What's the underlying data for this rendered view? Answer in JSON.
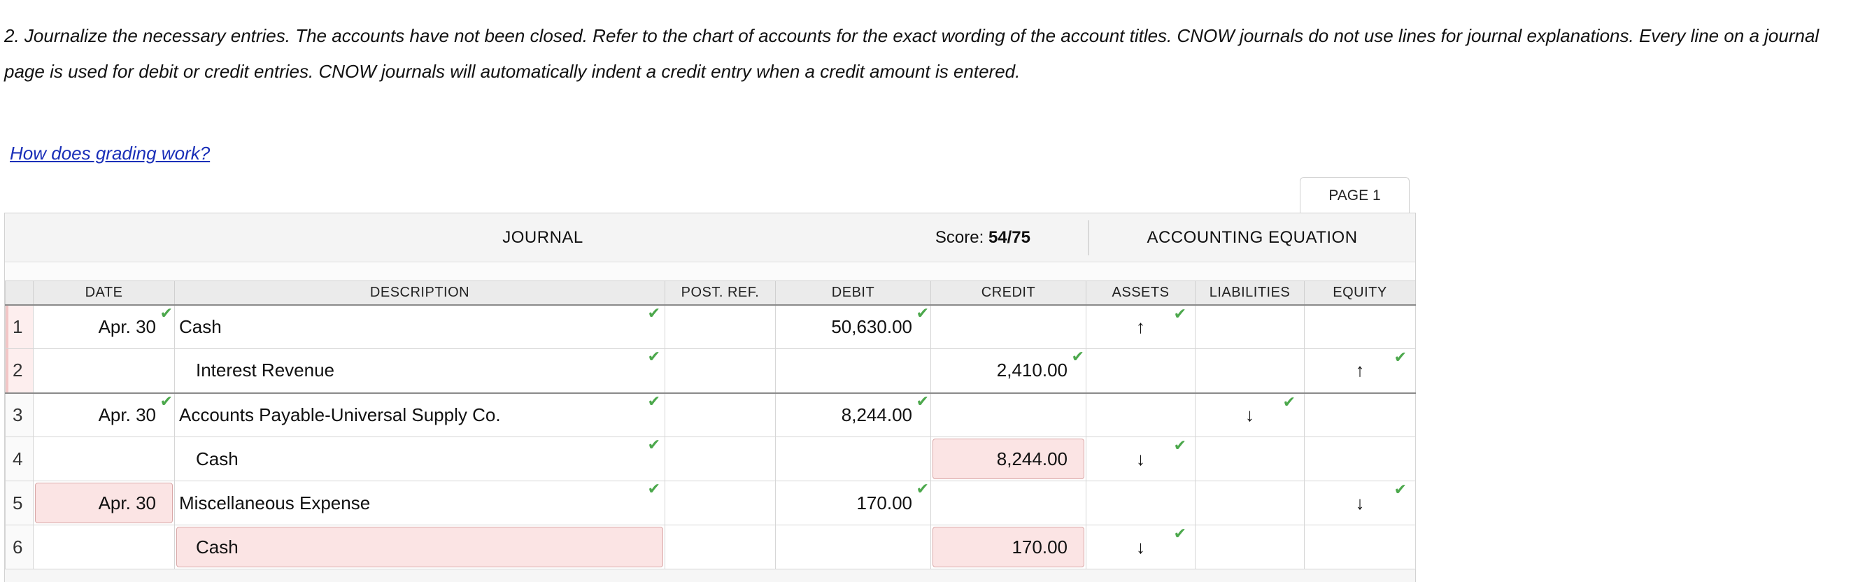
{
  "instructions": "2. Journalize the necessary entries. The accounts have not been closed. Refer to the chart of accounts for the exact wording of the account titles. CNOW journals do not use lines for journal explanations. Every line on a journal page is used for debit or credit entries. CNOW journals will automatically indent a credit entry when a credit amount is entered.",
  "help_link": "How does grading work?",
  "page_tab": "PAGE 1",
  "journal": {
    "title": "JOURNAL",
    "score_label": "Score:",
    "score_value": "54/75",
    "equation_title": "ACCOUNTING EQUATION",
    "columns": {
      "date": "DATE",
      "description": "DESCRIPTION",
      "post_ref": "POST. REF.",
      "debit": "DEBIT",
      "credit": "CREDIT",
      "assets": "ASSETS",
      "liabilities": "LIABILITIES",
      "equity": "EQUITY"
    },
    "rows": [
      {
        "num": "1",
        "date": "Apr. 30",
        "description": "Cash",
        "post_ref": "",
        "debit": "50,630.00",
        "credit": "",
        "assets": "↑",
        "liabilities": "",
        "equity": ""
      },
      {
        "num": "2",
        "date": "",
        "description": "Interest Revenue",
        "post_ref": "",
        "debit": "",
        "credit": "2,410.00",
        "assets": "",
        "liabilities": "",
        "equity": "↑"
      },
      {
        "num": "3",
        "date": "Apr. 30",
        "description": "Accounts Payable-Universal Supply Co.",
        "post_ref": "",
        "debit": "8,244.00",
        "credit": "",
        "assets": "",
        "liabilities": "↓",
        "equity": ""
      },
      {
        "num": "4",
        "date": "",
        "description": "Cash",
        "post_ref": "",
        "debit": "",
        "credit": "8,244.00",
        "assets": "↓",
        "liabilities": "",
        "equity": ""
      },
      {
        "num": "5",
        "date": "Apr. 30",
        "description": "Miscellaneous Expense",
        "post_ref": "",
        "debit": "170.00",
        "credit": "",
        "assets": "",
        "liabilities": "",
        "equity": "↓"
      },
      {
        "num": "6",
        "date": "",
        "description": "Cash",
        "post_ref": "",
        "debit": "",
        "credit": "170.00",
        "assets": "↓",
        "liabilities": "",
        "equity": ""
      }
    ]
  },
  "colors": {
    "correct_check": "#4ca84c",
    "error_fill": "#fbe4e4",
    "link": "#1a2fb8"
  },
  "icons": {
    "check": "check-icon",
    "arrow_up": "arrow-up-icon",
    "arrow_down": "arrow-down-icon"
  }
}
